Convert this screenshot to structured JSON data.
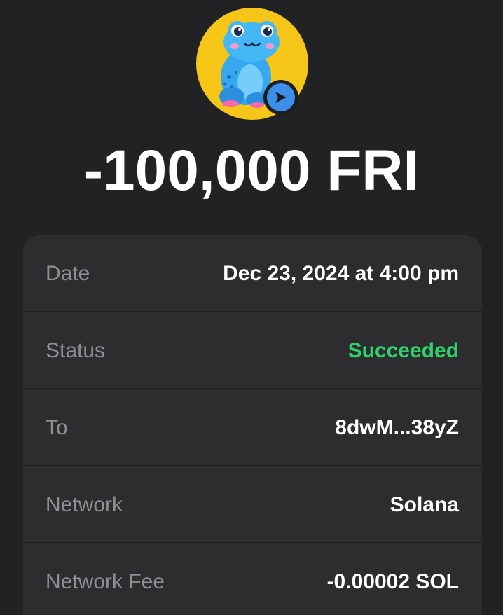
{
  "transaction": {
    "amount": "-100,000 FRI",
    "token_icon": "frog-token-icon",
    "direction_icon": "send-arrow-icon"
  },
  "details": {
    "date": {
      "label": "Date",
      "value": "Dec 23, 2024 at 4:00 pm"
    },
    "status": {
      "label": "Status",
      "value": "Succeeded",
      "color": "#2fd26a"
    },
    "to": {
      "label": "To",
      "value": "8dwM...38yZ"
    },
    "network": {
      "label": "Network",
      "value": "Solana"
    },
    "fee": {
      "label": "Network Fee",
      "value": "-0.00002 SOL"
    }
  },
  "colors": {
    "background": "#222224",
    "card": "#2d2d30",
    "accent_blue": "#3b8fe8",
    "avatar_yellow": "#f5c518"
  }
}
